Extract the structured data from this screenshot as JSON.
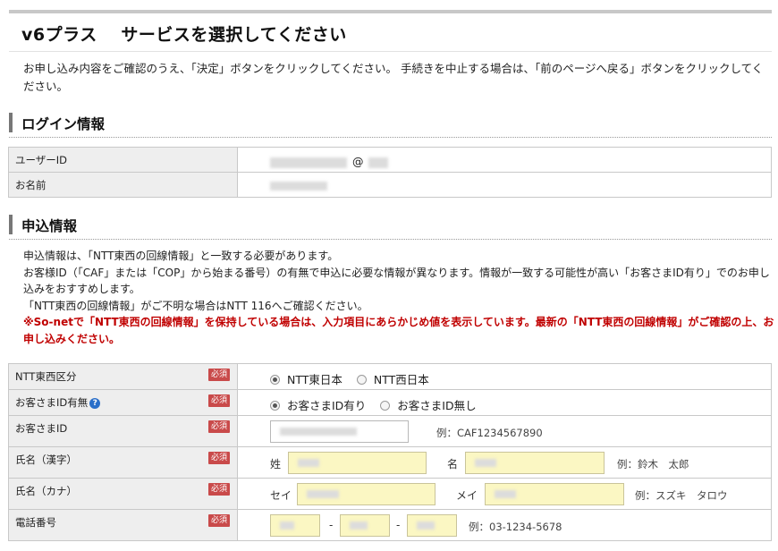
{
  "page": {
    "title": "v6プラス　 サービスを選択してください",
    "intro": "お申し込み内容をご確認のうえ、「決定」ボタンをクリックしてください。 手続きを中止する場合は、「前のページへ戻る」ボタンをクリックしてください。"
  },
  "login": {
    "heading": "ログイン情報",
    "user_id_label": "ユーザーID",
    "user_id_at": "@",
    "name_label": "お名前"
  },
  "apply": {
    "heading": "申込情報",
    "info_lines": [
      "申込情報は、「NTT東西の回線情報」と一致する必要があります。",
      "お客様ID（「CAF」または「COP」から始まる番号）の有無で申込に必要な情報が異なります。情報が一致する可能性が高い「お客さまID有り」でのお申し込みをおすすめします。",
      "「NTT東西の回線情報」がご不明な場合はNTT 116へご確認ください。"
    ],
    "info_warning": "※So-netで「NTT東西の回線情報」を保持している場合は、入力項目にあらかじめ値を表示しています。最新の「NTT東西の回線情報」がご確認の上、お申し込みください。",
    "required_badge": "必須",
    "ntt_label": "NTT東西区分",
    "ntt_options": [
      "NTT東日本",
      "NTT西日本"
    ],
    "custid_has_label": "お客さまID有無",
    "custid_has_options": [
      "お客さまID有り",
      "お客さまID無し"
    ],
    "custid_label": "お客さまID",
    "custid_example": "例：CAF1234567890",
    "kanji_label": "氏名（漢字）",
    "kanji_sei": "姓",
    "kanji_mei": "名",
    "kanji_example": "例：鈴木　太郎",
    "kana_label": "氏名（カナ）",
    "kana_sei": "セイ",
    "kana_mei": "メイ",
    "kana_example": "例：スズキ　タロウ",
    "phone_label": "電話番号",
    "phone_dash": "-",
    "phone_example": "例：03-1234-5678"
  }
}
